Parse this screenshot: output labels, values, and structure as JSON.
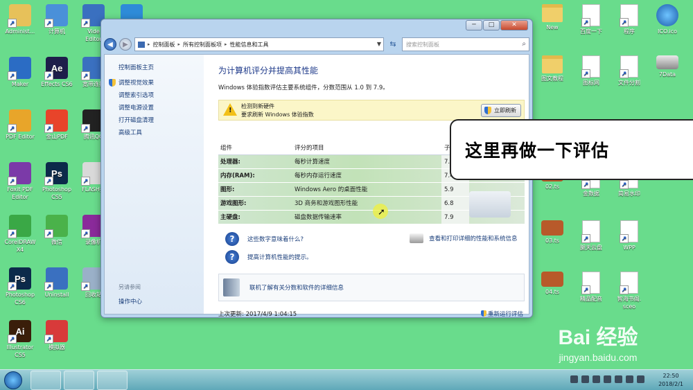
{
  "desktop_left": [
    {
      "label": "Administ...",
      "icon": "user-folder-icon",
      "color": "#e7c15a"
    },
    {
      "label": "计算机",
      "icon": "computer-icon",
      "color": "#4a90d9"
    },
    {
      "label": "Vide\nEditor",
      "icon": "video-editor-icon",
      "color": "#3a70c0"
    },
    {
      "label": "",
      "icon": "network-globe-icon",
      "color": "#2e8bd8"
    },
    {
      "label": "Maker",
      "icon": "maker-icon",
      "color": "#2b6cc4"
    },
    {
      "label": "Effects CS6",
      "icon": "after-effects-icon",
      "color": "#1e1e4a",
      "letter": "Ae"
    },
    {
      "label": "宽带连接",
      "icon": "broadband-icon",
      "color": "#3a70c0"
    },
    {
      "label": "PDF Editor",
      "icon": "pdf-editor-icon",
      "color": "#e8a52a"
    },
    {
      "label": "金山PDF",
      "icon": "kingsoft-pdf-icon",
      "color": "#e8442a"
    },
    {
      "label": "腾讯QQ",
      "icon": "qq-penguin-icon",
      "color": "#222222"
    },
    {
      "label": "Foxit PDF\nEditor",
      "icon": "foxit-icon",
      "color": "#7b3aa8"
    },
    {
      "label": "Photoshop\nCS5",
      "icon": "photoshop-icon",
      "color": "#0c2a4a",
      "letter": "Ps"
    },
    {
      "label": "FLASH播",
      "icon": "flash-player-icon",
      "color": "#d9d9d9"
    },
    {
      "label": "CorelDRAW\nX4",
      "icon": "coreldraw-icon",
      "color": "#3aa846"
    },
    {
      "label": "微信",
      "icon": "wechat-icon",
      "color": "#4ab24a"
    },
    {
      "label": "录像机",
      "icon": "recorder-icon",
      "color": "#8a2a9a"
    },
    {
      "label": "Photoshop\nCS6",
      "icon": "photoshop-icon",
      "color": "#0c2a4a",
      "letter": "Ps"
    },
    {
      "label": "Uninstall",
      "icon": "uninstall-icon",
      "color": "#3a70c0"
    },
    {
      "label": "回收站",
      "icon": "recycle-bin-icon",
      "color": "#9ab0c8"
    },
    {
      "label": "Illustrator\nCS5",
      "icon": "illustrator-icon",
      "color": "#3a1e0a",
      "letter": "Ai"
    },
    {
      "label": "模拟器",
      "icon": "emulator-icon",
      "color": "#d83a3a"
    }
  ],
  "desktop_right": [
    {
      "label": "New",
      "icon": "folder-icon"
    },
    {
      "label": "百度一下",
      "icon": "document-icon"
    },
    {
      "label": "程序",
      "icon": "document-icon"
    },
    {
      "label": "ICO.ico",
      "icon": "ico-globe-icon"
    },
    {
      "label": "图文教程",
      "icon": "folder-icon"
    },
    {
      "label": "图标网",
      "icon": "document-icon"
    },
    {
      "label": "文件分割",
      "icon": "document-icon"
    },
    {
      "label": "7Data",
      "icon": "drive-icon"
    },
    {
      "label": "02.ts",
      "icon": "video-file-icon"
    },
    {
      "label": "金数据",
      "icon": "document-icon"
    },
    {
      "label": "简易水印",
      "icon": "document-icon"
    },
    {
      "label": "03.ts",
      "icon": "video-file-icon"
    },
    {
      "label": "腿天云盘",
      "icon": "document-icon"
    },
    {
      "label": "WPP",
      "icon": "document-icon"
    },
    {
      "label": "04.ts",
      "icon": "video-file-icon"
    },
    {
      "label": "精品配音",
      "icon": "document-icon"
    },
    {
      "label": "智海书阁.\nsceo",
      "icon": "document-icon"
    }
  ],
  "window": {
    "minimize": "─",
    "maximize": "□",
    "close": "✕",
    "breadcrumb": [
      "控制面板",
      "所有控制面板项",
      "性能信息和工具"
    ],
    "search_placeholder": "搜索控制面板"
  },
  "sidebar": {
    "items": [
      "控制面板主页",
      "调整视觉效果",
      "调整索引选项",
      "调整电源设置",
      "打开磁盘清理",
      "高级工具"
    ],
    "see_also": "另请参阅",
    "action_center": "操作中心"
  },
  "main": {
    "title": "为计算机评分并提高其性能",
    "subtitle": "Windows 体验指数评估主要系统组件，分数范围从 1.0 到 7.9。",
    "alert_line1": "检测到新硬件",
    "alert_line2": "要求刷新 Windows 体验指数",
    "refresh_button": "立即刷新",
    "headers": {
      "component": "组件",
      "rated": "评分的项目",
      "subscore": "子分数"
    },
    "rows": [
      {
        "component": "处理器:",
        "item": "每秒计算速度",
        "score": "7.4"
      },
      {
        "component": "内存(RAM):",
        "item": "每秒内存运行速度",
        "score": "7.4"
      },
      {
        "component": "图形:",
        "item": "Windows Aero 的桌面性能",
        "score": "5.9"
      },
      {
        "component": "游戏图形:",
        "item": "3D 商务和游戏图形性能",
        "score": "6.8"
      },
      {
        "component": "主硬盘:",
        "item": "磁盘数据传输速率",
        "score": "7.9"
      }
    ],
    "help_link1": "这些数字意味着什么?",
    "help_link2": "提高计算机性能的提示。",
    "print_link": "查看和打印详细的性能和系统信息",
    "learn_link": "联机了解有关分数和软件的详细信息",
    "last_update": "上次更新: 2017/4/9 1:04:15",
    "rerun": "重新运行评估"
  },
  "callout": "这里再做一下评估",
  "taskbar": {
    "time": "22:50",
    "date": "2018/2/1"
  },
  "watermark": {
    "brand": "Bai 经验",
    "url": "jingyan.baidu.com"
  }
}
